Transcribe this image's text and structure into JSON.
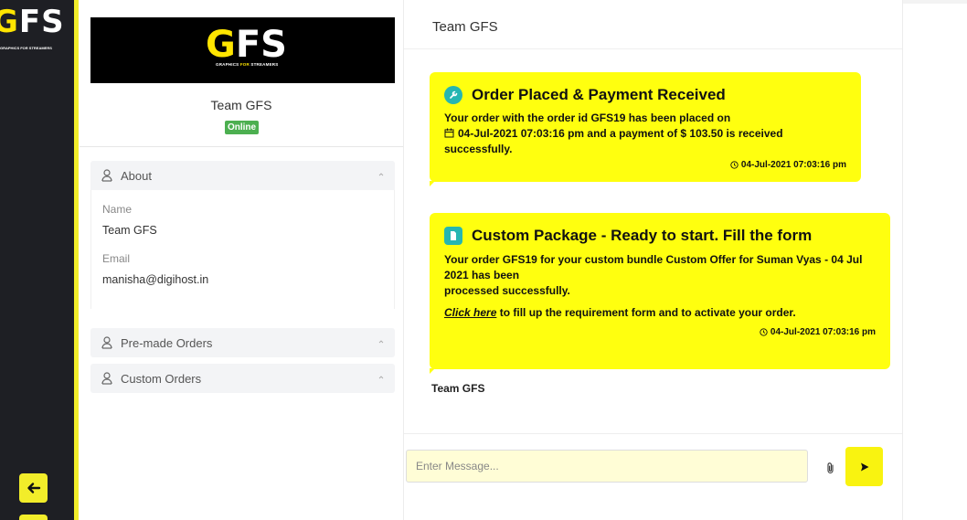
{
  "rail": {
    "logo_text": "GFS",
    "logo_tagline": "GRAPHICS FOR STREAMERS",
    "back_icon": "arrow-left-icon"
  },
  "profile": {
    "banner_logo": "GFS",
    "banner_tag_prefix": "GRAPHICS ",
    "banner_tag_mid": "FOR",
    "banner_tag_suffix": " STREAMERS",
    "name": "Team GFS",
    "status": "Online",
    "sections": {
      "about": {
        "title": "About",
        "fields": [
          {
            "label": "Name",
            "value": "Team GFS"
          },
          {
            "label": "Email",
            "value": "manisha@digihost.in"
          }
        ]
      },
      "premade": {
        "title": "Pre-made Orders"
      },
      "custom": {
        "title": "Custom Orders"
      }
    }
  },
  "chat": {
    "title": "Team GFS",
    "messages": [
      {
        "title": "Order Placed & Payment Received",
        "line1": "Your order with the order id GFS19 has been placed on",
        "line2": "04-Jul-2021 07:03:16 pm and a payment of $ 103.50 is received successfully.",
        "time": "04-Jul-2021 07:03:16 pm"
      },
      {
        "title": "Custom Package - Ready to start. Fill the form",
        "line1": "Your order GFS19 for your custom bundle Custom Offer for Suman Vyas - 04 Jul 2021 has been",
        "line2": "processed successfully.",
        "link": "Click here",
        "link_suffix": " to fill up the requirement form and to activate your order.",
        "time": "04-Jul-2021 07:03:16 pm"
      }
    ],
    "sender": "Team GFS",
    "input_placeholder": "Enter Message...",
    "colors": {
      "bubble": "#ffff0f",
      "accent": "#f2ed2a",
      "online": "#4caf50",
      "sidebar": "#1e1f24"
    }
  }
}
